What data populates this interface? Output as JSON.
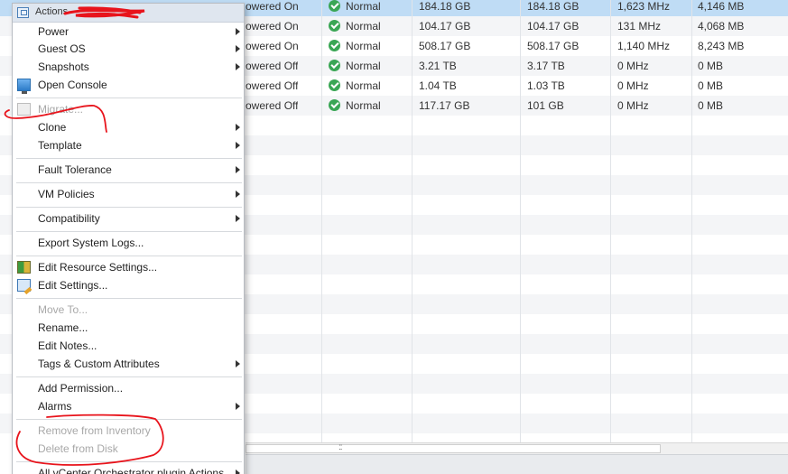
{
  "grid": {
    "rows": [
      {
        "state": "owered On",
        "status": "Normal",
        "provisioned": "184.18  GB",
        "used": "184.18  GB",
        "cpu": "1,623 MHz",
        "memory": "4,146 MB"
      },
      {
        "state": "owered On",
        "status": "Normal",
        "provisioned": "104.17  GB",
        "used": "104.17  GB",
        "cpu": "131 MHz",
        "memory": "4,068 MB"
      },
      {
        "state": "owered On",
        "status": "Normal",
        "provisioned": "508.17  GB",
        "used": "508.17  GB",
        "cpu": "1,140 MHz",
        "memory": "8,243 MB"
      },
      {
        "state": "owered Off",
        "status": "Normal",
        "provisioned": "3.21  TB",
        "used": "3.17  TB",
        "cpu": "0 MHz",
        "memory": "0 MB"
      },
      {
        "state": "owered Off",
        "status": "Normal",
        "provisioned": "1.04  TB",
        "used": "1.03  TB",
        "cpu": "0 MHz",
        "memory": "0 MB"
      },
      {
        "state": "owered Off",
        "status": "Normal",
        "provisioned": "117.17  GB",
        "used": "101  GB",
        "cpu": "0 MHz",
        "memory": "0 MB"
      }
    ]
  },
  "menu": {
    "header": "Actions -",
    "items": {
      "power": "Power",
      "guest_os": "Guest OS",
      "snapshots": "Snapshots",
      "open_console": "Open Console",
      "migrate": "Migrate...",
      "clone": "Clone",
      "template": "Template",
      "fault_tolerance": "Fault Tolerance",
      "vm_policies": "VM Policies",
      "compatibility": "Compatibility",
      "export_logs": "Export System Logs...",
      "edit_resource": "Edit Resource Settings...",
      "edit_settings": "Edit Settings...",
      "move_to": "Move To...",
      "rename": "Rename...",
      "edit_notes": "Edit Notes...",
      "tags": "Tags & Custom Attributes",
      "add_permission": "Add Permission...",
      "alarms": "Alarms",
      "remove_inventory": "Remove from Inventory",
      "delete_disk": "Delete from Disk",
      "orchestrator": "All vCenter Orchestrator plugin Actions"
    }
  },
  "scrollbar": {
    "grip": "::"
  },
  "colors": {
    "selected_row": "#bfdcf5",
    "status_ok": "#3aa655",
    "annotation": "#e8141c"
  }
}
